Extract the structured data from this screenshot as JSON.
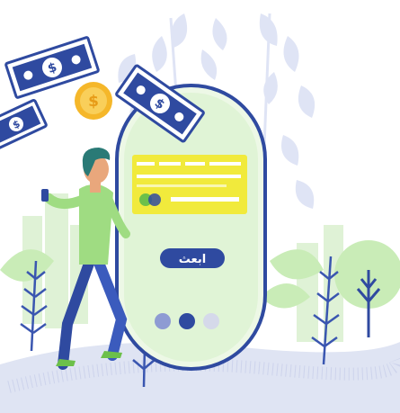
{
  "illustration": {
    "send_button_label": "ابعث",
    "pagination": {
      "count": 3,
      "active_index": 1
    },
    "colors": {
      "navy": "#2f4aa0",
      "card_yellow": "#f1ea3c",
      "leaf_light": "#dfe4f5",
      "green_light": "#c9ecb7",
      "green": "#6cc04a",
      "coin": "#f5b72a",
      "skin": "#e9a77c",
      "hair": "#2a7a76"
    },
    "icons": [
      "dollar-bill-icon",
      "coin-icon",
      "credit-card-icon",
      "leaf-icon",
      "tree-icon"
    ]
  }
}
